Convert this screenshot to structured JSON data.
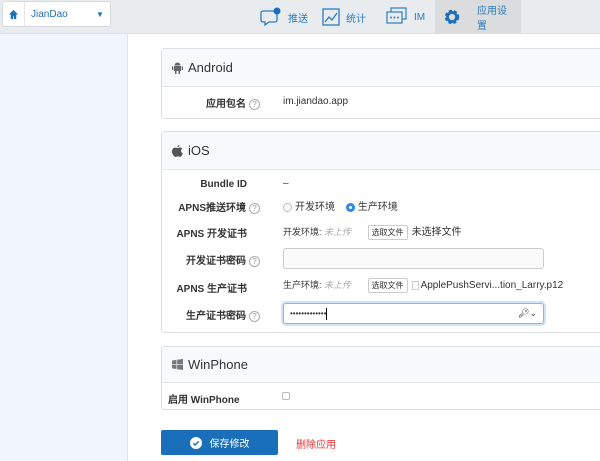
{
  "colors": {
    "accent": "#1a6fba",
    "danger": "#ee3333",
    "nav": "#2d7cc0"
  },
  "header": {
    "app_name": "JianDao",
    "nav": [
      {
        "label": "推送",
        "icon": "chat-bubble-icon"
      },
      {
        "label": "统计",
        "icon": "chart-icon"
      },
      {
        "label": "IM",
        "icon": "message-icon"
      },
      {
        "label": "应用设置",
        "icon": "gear-icon",
        "active": true
      }
    ]
  },
  "android": {
    "title": "Android",
    "package_label": "应用包名",
    "package_value": "im.jiandao.app"
  },
  "ios": {
    "title": "iOS",
    "bundle_label": "Bundle ID",
    "bundle_value": "–",
    "env_label": "APNS推送环境",
    "env_options": [
      "开发环境",
      "生产环境"
    ],
    "env_selected": "生产环境",
    "dev_cert_label": "APNS 开发证书",
    "dev_cert_prefix": "开发环境:",
    "dev_cert_status": "未上传",
    "choose_file": "选取文件",
    "dev_file": "未选择文件",
    "dev_pwd_label": "开发证书密码",
    "dev_pwd_value": "",
    "prod_cert_label": "APNS 生产证书",
    "prod_cert_prefix": "生产环境:",
    "prod_cert_status": "未上传",
    "prod_file": "ApplePushServi...tion_Larry.p12",
    "prod_pwd_label": "生产证书密码",
    "prod_pwd_value": "•••••••••••••"
  },
  "winphone": {
    "title": "WinPhone",
    "enable_label": "启用 WinPhone",
    "enabled": false
  },
  "actions": {
    "save": "保存修改",
    "delete": "删除应用"
  }
}
